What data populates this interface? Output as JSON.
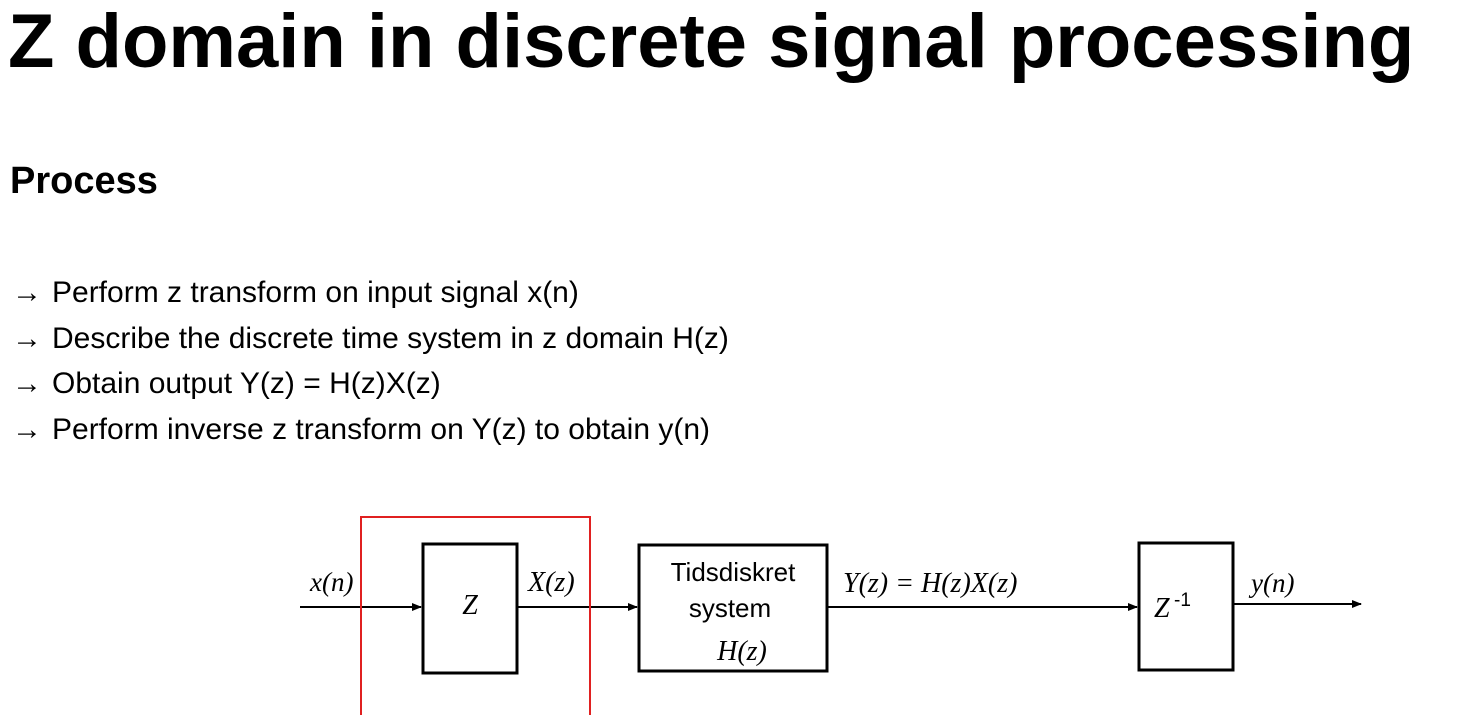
{
  "page": {
    "title": "Z domain in discrete signal processing",
    "section": "Process"
  },
  "steps": [
    {
      "arrow": "→",
      "text": "Perform z transform on input signal x(n)"
    },
    {
      "arrow": "→",
      "text": "Describe the discrete time system in z domain H(z)"
    },
    {
      "arrow": "→",
      "text": "Obtain output Y(z) = H(z)X(z)"
    },
    {
      "arrow": "→",
      "text": "Perform inverse z transform on Y(z) to obtain y(n)"
    }
  ],
  "diagram": {
    "input_label": "x(n)",
    "z_block_label": "Z",
    "xz_label": "X(z)",
    "system_line1": "Tidsdiskret",
    "system_line2": "system",
    "system_line3": "H(z)",
    "yz_label": "Y(z) = H(z)X(z)",
    "inverse_block_label": "Z",
    "inverse_block_exponent": "-1",
    "output_label": "y(n)",
    "highlight_color": "#e02020"
  }
}
